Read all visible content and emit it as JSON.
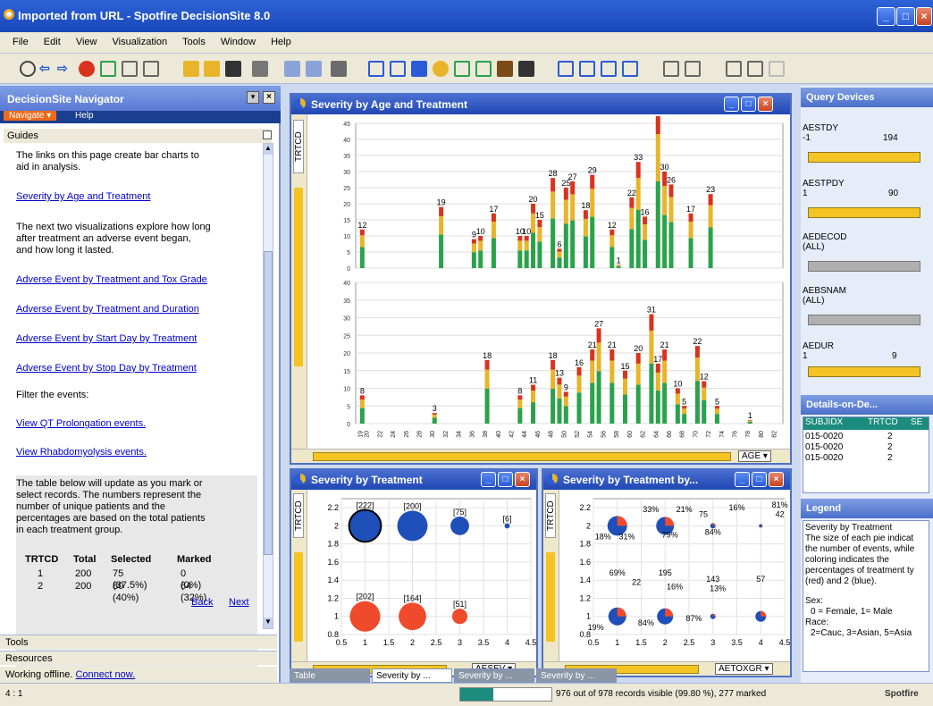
{
  "window": {
    "title": "Imported from URL - Spotfire DecisionSite 8.0"
  },
  "menu": [
    "File",
    "Edit",
    "View",
    "Visualization",
    "Tools",
    "Window",
    "Help"
  ],
  "nav": {
    "title": "DecisionSite Navigator",
    "tabs": [
      "Navigate ▾",
      "Help"
    ],
    "guides_header": "Guides",
    "intro": [
      "The links on this page create bar charts to",
      "aid in analysis."
    ],
    "link1": "Severity by Age and Treatment",
    "para2": [
      "The next two visualizations explore how long",
      "after treatment an adverse event began,",
      "and how long it lasted."
    ],
    "links": [
      "Adverse Event by Treatment and Tox Grade",
      "Adverse Event by Treatment and Duration",
      "Adverse Event by Start Day by Treatment",
      "Adverse Event by Stop Day by Treatment"
    ],
    "filter_label": "Filter the events:",
    "filter_links": [
      "View QT Prolongation events.",
      "View Rhabdomyolysis events."
    ],
    "table_intro": [
      "The table below will update as you mark or",
      "select records. The numbers represent the",
      "number of unique patients and the",
      "percentages are based on the total patients",
      "in each treatment group."
    ],
    "summary": {
      "headers": [
        "TRTCD",
        "Total",
        "Selected",
        "Marked"
      ],
      "rows": [
        [
          "1",
          "200",
          "75 (37.5%)",
          "0 (0%)"
        ],
        [
          "2",
          "200",
          "80 (40%)",
          "64 (32%)"
        ]
      ],
      "back": "Back",
      "next": "Next"
    },
    "tools": "Tools",
    "resources": "Resources",
    "offline": "Working offline.",
    "connect": "Connect now."
  },
  "viz_main": {
    "title": "Severity by Age and Treatment",
    "side_label": "TRTCD",
    "axis_dropdown": "AGE ▾"
  },
  "viz_sev_trt": {
    "title": "Severity by Treatment",
    "side_label": "TRTCD",
    "axis_dropdown": "AESEV ▾"
  },
  "viz_sev_trt2": {
    "title": "Severity by Treatment by...",
    "side_label": "TRTCD",
    "axis_dropdown": "AETOXGR ▾"
  },
  "query_devices": {
    "title": "Query Devices",
    "items": [
      {
        "name": "AESTDY",
        "min": "-1",
        "max": "194"
      },
      {
        "name": "AESTPDY",
        "min": "1",
        "max": "90"
      },
      {
        "name": "AEDECOD",
        "value": "(ALL)"
      },
      {
        "name": "AEBSNAM",
        "value": "(ALL)"
      },
      {
        "name": "AEDUR",
        "min": "1",
        "max": "9"
      }
    ]
  },
  "details": {
    "title": "Details-on-De...",
    "headers": [
      "SUBJIDX",
      "TRTCD",
      "SE"
    ],
    "rows": [
      [
        "015-0020",
        "2"
      ],
      [
        "015-0020",
        "2"
      ],
      [
        "015-0020",
        "2"
      ]
    ]
  },
  "legend": {
    "title": "Legend",
    "heading": "Severity by Treatment",
    "text": [
      "The size of each pie indicat",
      "the number of events, while",
      "coloring indicates the",
      "percentages of treatment ty",
      "(red) and 2 (blue)."
    ],
    "sex": [
      "Sex:",
      "0 = Female, 1= Male"
    ],
    "race": [
      "Race:",
      "2=Cauc, 3=Asian, 5=Asia"
    ]
  },
  "tabs": [
    "Table",
    "Severity by ...",
    "Severity by ...",
    "Severity by ..."
  ],
  "status": {
    "left": "4 : 1",
    "records": "976 out of 978 records visible (99.80 %), 277 marked",
    "logo": "Spotfire"
  },
  "colors": {
    "green": "#2aa24b",
    "yellow": "#e8b52a",
    "red": "#d8331e",
    "blue": "#1f4fb8",
    "orange": "#ef4a2c"
  },
  "chart_data": [
    {
      "type": "bar",
      "title": "Severity by Age and Treatment",
      "panels": [
        "TRTCD 1",
        "TRTCD 2"
      ],
      "xlabel": "AGE",
      "x_categories": [
        "19",
        "20",
        "22",
        "24",
        "26",
        "28",
        "30",
        "32",
        "34",
        "36",
        "38",
        "40",
        "42",
        "44",
        "46",
        "48",
        "50",
        "52",
        "54",
        "56",
        "58",
        "60",
        "62",
        "64",
        "66",
        "68",
        "70",
        "72",
        "74",
        "76",
        "78",
        "80",
        "82"
      ],
      "top_panel_labels": [
        {
          "x": "19",
          "v": 12
        },
        {
          "x": "31",
          "v": 19
        },
        {
          "x": "36",
          "v": 9
        },
        {
          "x": "37",
          "v": 10
        },
        {
          "x": "39",
          "v": 17
        },
        {
          "x": "43",
          "v": 10
        },
        {
          "x": "44",
          "v": 10
        },
        {
          "x": "45",
          "v": 20
        },
        {
          "x": "46",
          "v": 15
        },
        {
          "x": "48",
          "v": 28
        },
        {
          "x": "49",
          "v": 6
        },
        {
          "x": "50",
          "v": 25
        },
        {
          "x": "51",
          "v": 27
        },
        {
          "x": "53",
          "v": 18
        },
        {
          "x": "54",
          "v": 29
        },
        {
          "x": "57",
          "v": 12
        },
        {
          "x": "58",
          "v": 1
        },
        {
          "x": "60",
          "v": 22
        },
        {
          "x": "61",
          "v": 33
        },
        {
          "x": "62",
          "v": 16
        },
        {
          "x": "64",
          "v": 49
        },
        {
          "x": "65",
          "v": 30
        },
        {
          "x": "66",
          "v": 26
        },
        {
          "x": "69",
          "v": 17
        },
        {
          "x": "72",
          "v": 23
        }
      ],
      "bottom_panel_labels": [
        {
          "x": "19",
          "v": 8
        },
        {
          "x": "30",
          "v": 3
        },
        {
          "x": "38",
          "v": 18
        },
        {
          "x": "43",
          "v": 8
        },
        {
          "x": "45",
          "v": 11
        },
        {
          "x": "48",
          "v": 18
        },
        {
          "x": "49",
          "v": 13
        },
        {
          "x": "50",
          "v": 9
        },
        {
          "x": "52",
          "v": 16
        },
        {
          "x": "54",
          "v": 21
        },
        {
          "x": "55",
          "v": 27
        },
        {
          "x": "57",
          "v": 21
        },
        {
          "x": "59",
          "v": 15
        },
        {
          "x": "61",
          "v": 20
        },
        {
          "x": "63",
          "v": 31
        },
        {
          "x": "64",
          "v": 17
        },
        {
          "x": "65",
          "v": 21
        },
        {
          "x": "67",
          "v": 10
        },
        {
          "x": "68",
          "v": 5
        },
        {
          "x": "70",
          "v": 22
        },
        {
          "x": "71",
          "v": 12
        },
        {
          "x": "73",
          "v": 5
        },
        {
          "x": "78",
          "v": 1
        }
      ],
      "yticks_top": [
        45,
        40,
        35,
        30,
        25,
        20,
        15,
        10,
        5,
        0
      ],
      "yticks_bottom": [
        40,
        35,
        30,
        25,
        20,
        15,
        10,
        5,
        0
      ]
    },
    {
      "type": "scatter",
      "title": "Severity by Treatment",
      "xlabel": "AESEV",
      "x_ticks": [
        "0.5",
        "1",
        "1.5",
        "2",
        "2.5",
        "3",
        "3.5",
        "4",
        "4.5"
      ],
      "y_ticks": [
        "2.2",
        "2",
        "1.8",
        "1.6",
        "1.4",
        "1.2",
        "1",
        "0.8"
      ],
      "points": [
        {
          "x": 1,
          "y": 2,
          "label": "[222]",
          "color": "blue",
          "size": 222
        },
        {
          "x": 2,
          "y": 2,
          "label": "[200]",
          "color": "blue",
          "size": 200
        },
        {
          "x": 3,
          "y": 2,
          "label": "[75]",
          "color": "blue",
          "size": 75
        },
        {
          "x": 4,
          "y": 2,
          "label": "[6]",
          "color": "blue",
          "size": 6
        },
        {
          "x": 1,
          "y": 1,
          "label": "[202]",
          "color": "red",
          "size": 202
        },
        {
          "x": 2,
          "y": 1,
          "label": "[164]",
          "color": "red",
          "size": 164
        },
        {
          "x": 3,
          "y": 1,
          "label": "[51]",
          "color": "red",
          "size": 51
        }
      ]
    },
    {
      "type": "scatter",
      "title": "Severity by Treatment by...",
      "xlabel": "AETOXGR",
      "x_ticks": [
        "0.5",
        "1",
        "1.5",
        "2",
        "2.5",
        "3",
        "3.5",
        "4",
        "4.5"
      ],
      "y_ticks": [
        "2.2",
        "2",
        "1.8",
        "1.6",
        "1.4",
        "1.2",
        "1",
        "0.8"
      ],
      "labels": [
        "18%",
        "33%",
        "21%",
        "75",
        "16%",
        "42",
        "31%",
        "79%",
        "84%",
        "69%",
        "195",
        "143",
        "57",
        "22",
        "16%",
        "13%",
        "19%",
        "84%",
        "87%",
        "81%"
      ]
    }
  ]
}
